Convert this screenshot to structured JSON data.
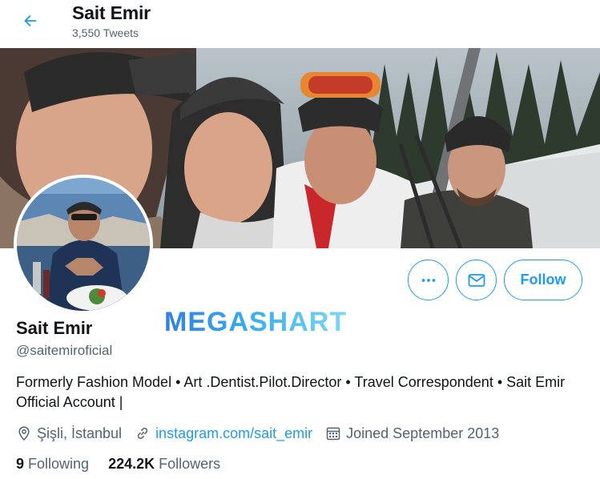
{
  "header": {
    "name": "Sait Emir",
    "tweet_count": "3,550 Tweets"
  },
  "profile": {
    "name": "Sait Emir",
    "handle": "@saitemiroficial",
    "bio": "Formerly Fashion Model • Art .Dentist.Pilot.Director • Travel Correspondent • Sait Emir Official Account |",
    "location": "Şişli, İstanbul",
    "website": "instagram.com/sait_emir",
    "joined": "Joined September 2013"
  },
  "actions": {
    "follow_label": "Follow"
  },
  "stats": {
    "following_count": "9",
    "following_label": "Following",
    "followers_count": "224.2K",
    "followers_label": "Followers"
  },
  "watermark": {
    "text": "MEGASHART"
  },
  "icons": {
    "back": "arrow-left-icon",
    "more": "more-dots-icon",
    "message": "envelope-icon",
    "location": "location-pin-icon",
    "link": "link-icon",
    "calendar": "calendar-icon"
  },
  "colors": {
    "accent": "#1d9bf0",
    "text_primary": "#0f1419",
    "text_secondary": "#536471"
  }
}
